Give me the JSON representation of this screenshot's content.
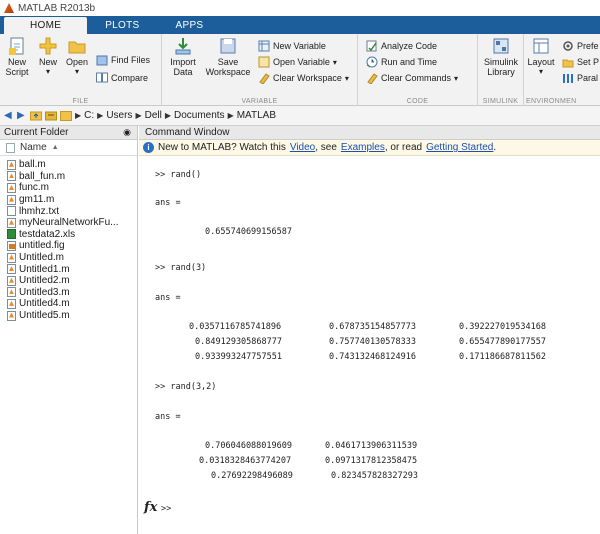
{
  "window": {
    "title": "MATLAB R2013b"
  },
  "tabs": [
    {
      "label": "HOME",
      "active": true
    },
    {
      "label": "PLOTS",
      "active": false
    },
    {
      "label": "APPS",
      "active": false
    }
  ],
  "ribbon": {
    "file": {
      "label": "FILE",
      "new_script": "New Script",
      "new": "New",
      "open": "Open",
      "find_files": "Find Files",
      "compare": "Compare"
    },
    "variable": {
      "label": "VARIABLE",
      "import_data": "Import Data",
      "save_workspace": "Save Workspace",
      "new_variable": "New Variable",
      "open_variable": "Open Variable",
      "clear_workspace": "Clear Workspace"
    },
    "code": {
      "label": "CODE",
      "analyze_code": "Analyze Code",
      "run_and_time": "Run and Time",
      "clear_commands": "Clear Commands"
    },
    "simulink": {
      "label": "SIMULINK",
      "simulink_library": "Simulink Library"
    },
    "environment": {
      "label": "ENVIRONMEN",
      "layout": "Layout",
      "preferences": "Prefe",
      "set_path": "Set P",
      "parallel": "Paral"
    }
  },
  "address": {
    "crumbs": [
      "C:",
      "Users",
      "Dell",
      "Documents",
      "MATLAB"
    ]
  },
  "current_folder": {
    "title": "Current Folder",
    "column_header": "Name",
    "files": [
      {
        "name": "ball.m",
        "type": "m"
      },
      {
        "name": "ball_fun.m",
        "type": "m"
      },
      {
        "name": "func.m",
        "type": "m"
      },
      {
        "name": "gm11.m",
        "type": "m"
      },
      {
        "name": "lhmhz.txt",
        "type": "txt"
      },
      {
        "name": "myNeuralNetworkFu...",
        "type": "m"
      },
      {
        "name": "testdata2.xls",
        "type": "xls"
      },
      {
        "name": "untitled.fig",
        "type": "fig"
      },
      {
        "name": "Untitled.m",
        "type": "m"
      },
      {
        "name": "Untitled1.m",
        "type": "m"
      },
      {
        "name": "Untitled2.m",
        "type": "m"
      },
      {
        "name": "Untitled3.m",
        "type": "m"
      },
      {
        "name": "Untitled4.m",
        "type": "m"
      },
      {
        "name": "Untitled5.m",
        "type": "m"
      }
    ]
  },
  "command_window": {
    "title": "Command Window",
    "banner": {
      "intro": "New to MATLAB? Watch this",
      "video": "Video",
      "sep1": ", see",
      "examples": "Examples",
      "sep2": ", or read",
      "getting_started": "Getting Started",
      "end": "."
    },
    "lines": {
      "cmd1": ">> rand()",
      "ans1": "ans =",
      "val1": "0.655740699156587",
      "cmd2": ">> rand(3)",
      "ans2": "ans =",
      "m3_r1c1": "0.0357116785741896",
      "m3_r1c2": "0.678735154857773",
      "m3_r1c3": "0.392227019534168",
      "m3_r2c1": "0.849129305868777",
      "m3_r2c2": "0.757740130578333",
      "m3_r2c3": "0.655477890177557",
      "m3_r3c1": "0.933993247757551",
      "m3_r3c2": "0.743132468124916",
      "m3_r3c3": "0.171186687811562",
      "cmd3": ">> rand(3,2)",
      "ans3": "ans =",
      "m32_r1c1": "0.706046088019609",
      "m32_r1c2": "0.0461713906311539",
      "m32_r2c1": "0.0318328463774207",
      "m32_r2c2": "0.0971317812358475",
      "m32_r3c1": "0.27692298496089",
      "m32_r3c2": "0.823457828327293",
      "prompt_fx": "fx",
      "prompt": ">>"
    }
  }
}
